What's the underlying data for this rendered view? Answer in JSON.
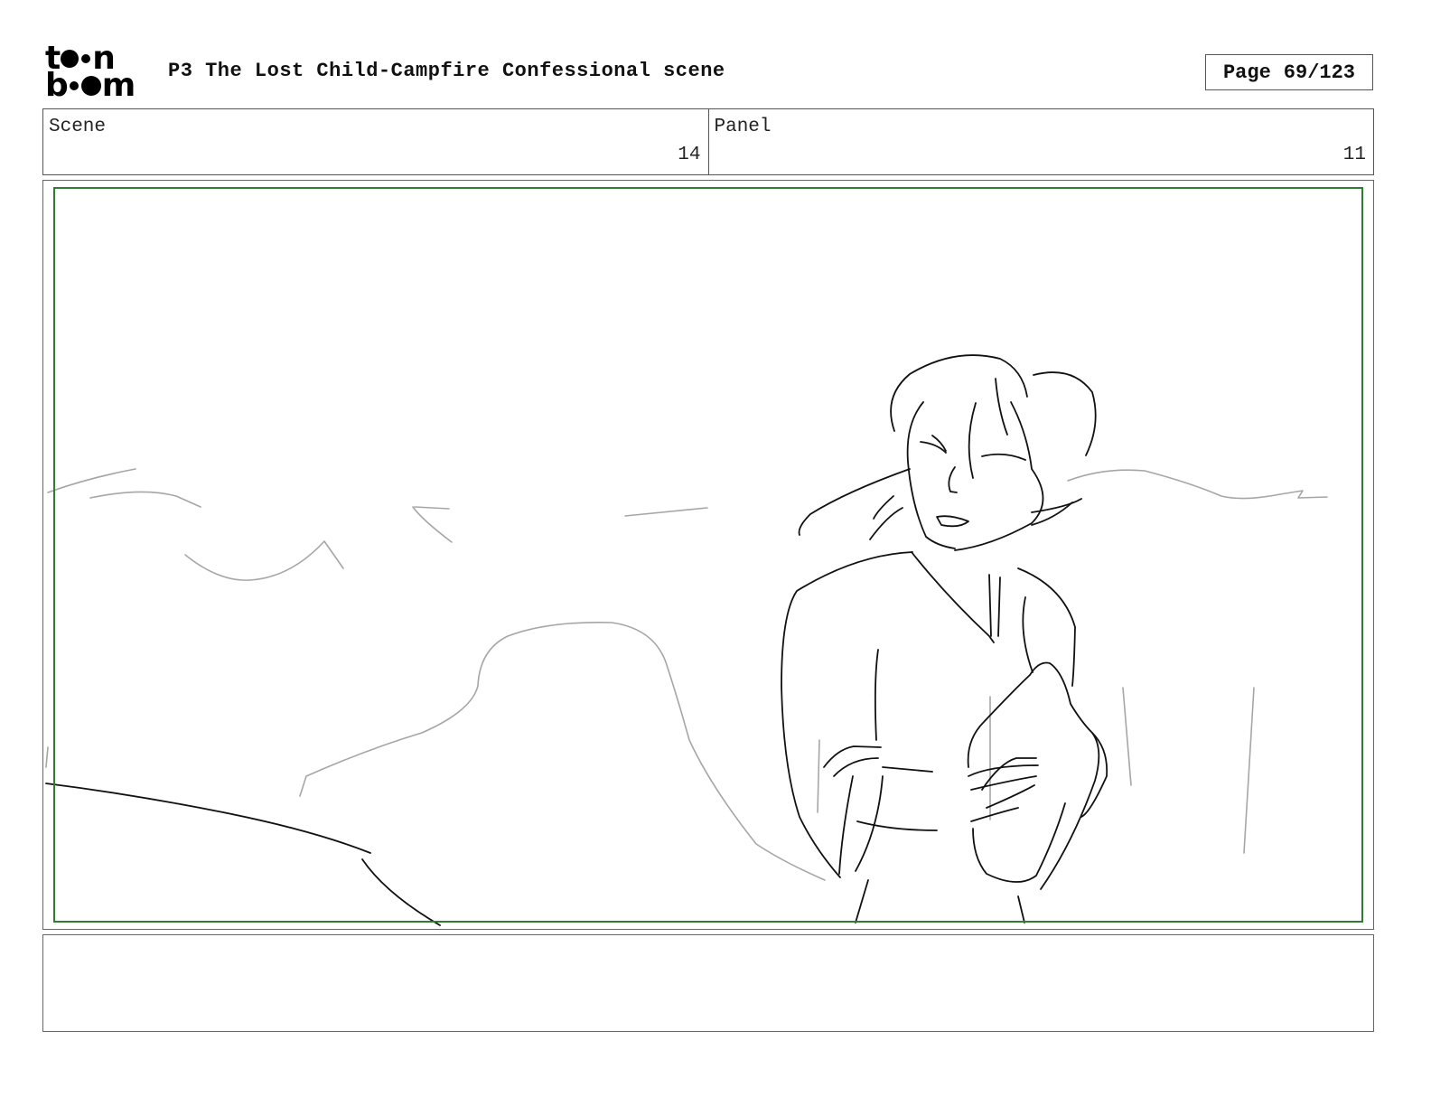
{
  "logo": {
    "line1": [
      "t",
      "o",
      "o",
      "n"
    ],
    "line2": [
      "b",
      "o",
      "o",
      "m"
    ]
  },
  "header": {
    "title": "P3 The Lost Child-Campfire Confessional scene",
    "page_label": "Page",
    "page_value": "69/123"
  },
  "info": {
    "scene_label": "Scene",
    "scene_value": "14",
    "panel_label": "Panel",
    "panel_value": "11"
  },
  "colors": {
    "safe_frame": "#2e7d32",
    "sketch_dark": "#111111",
    "sketch_light": "#a6a6a6"
  },
  "notes": ""
}
